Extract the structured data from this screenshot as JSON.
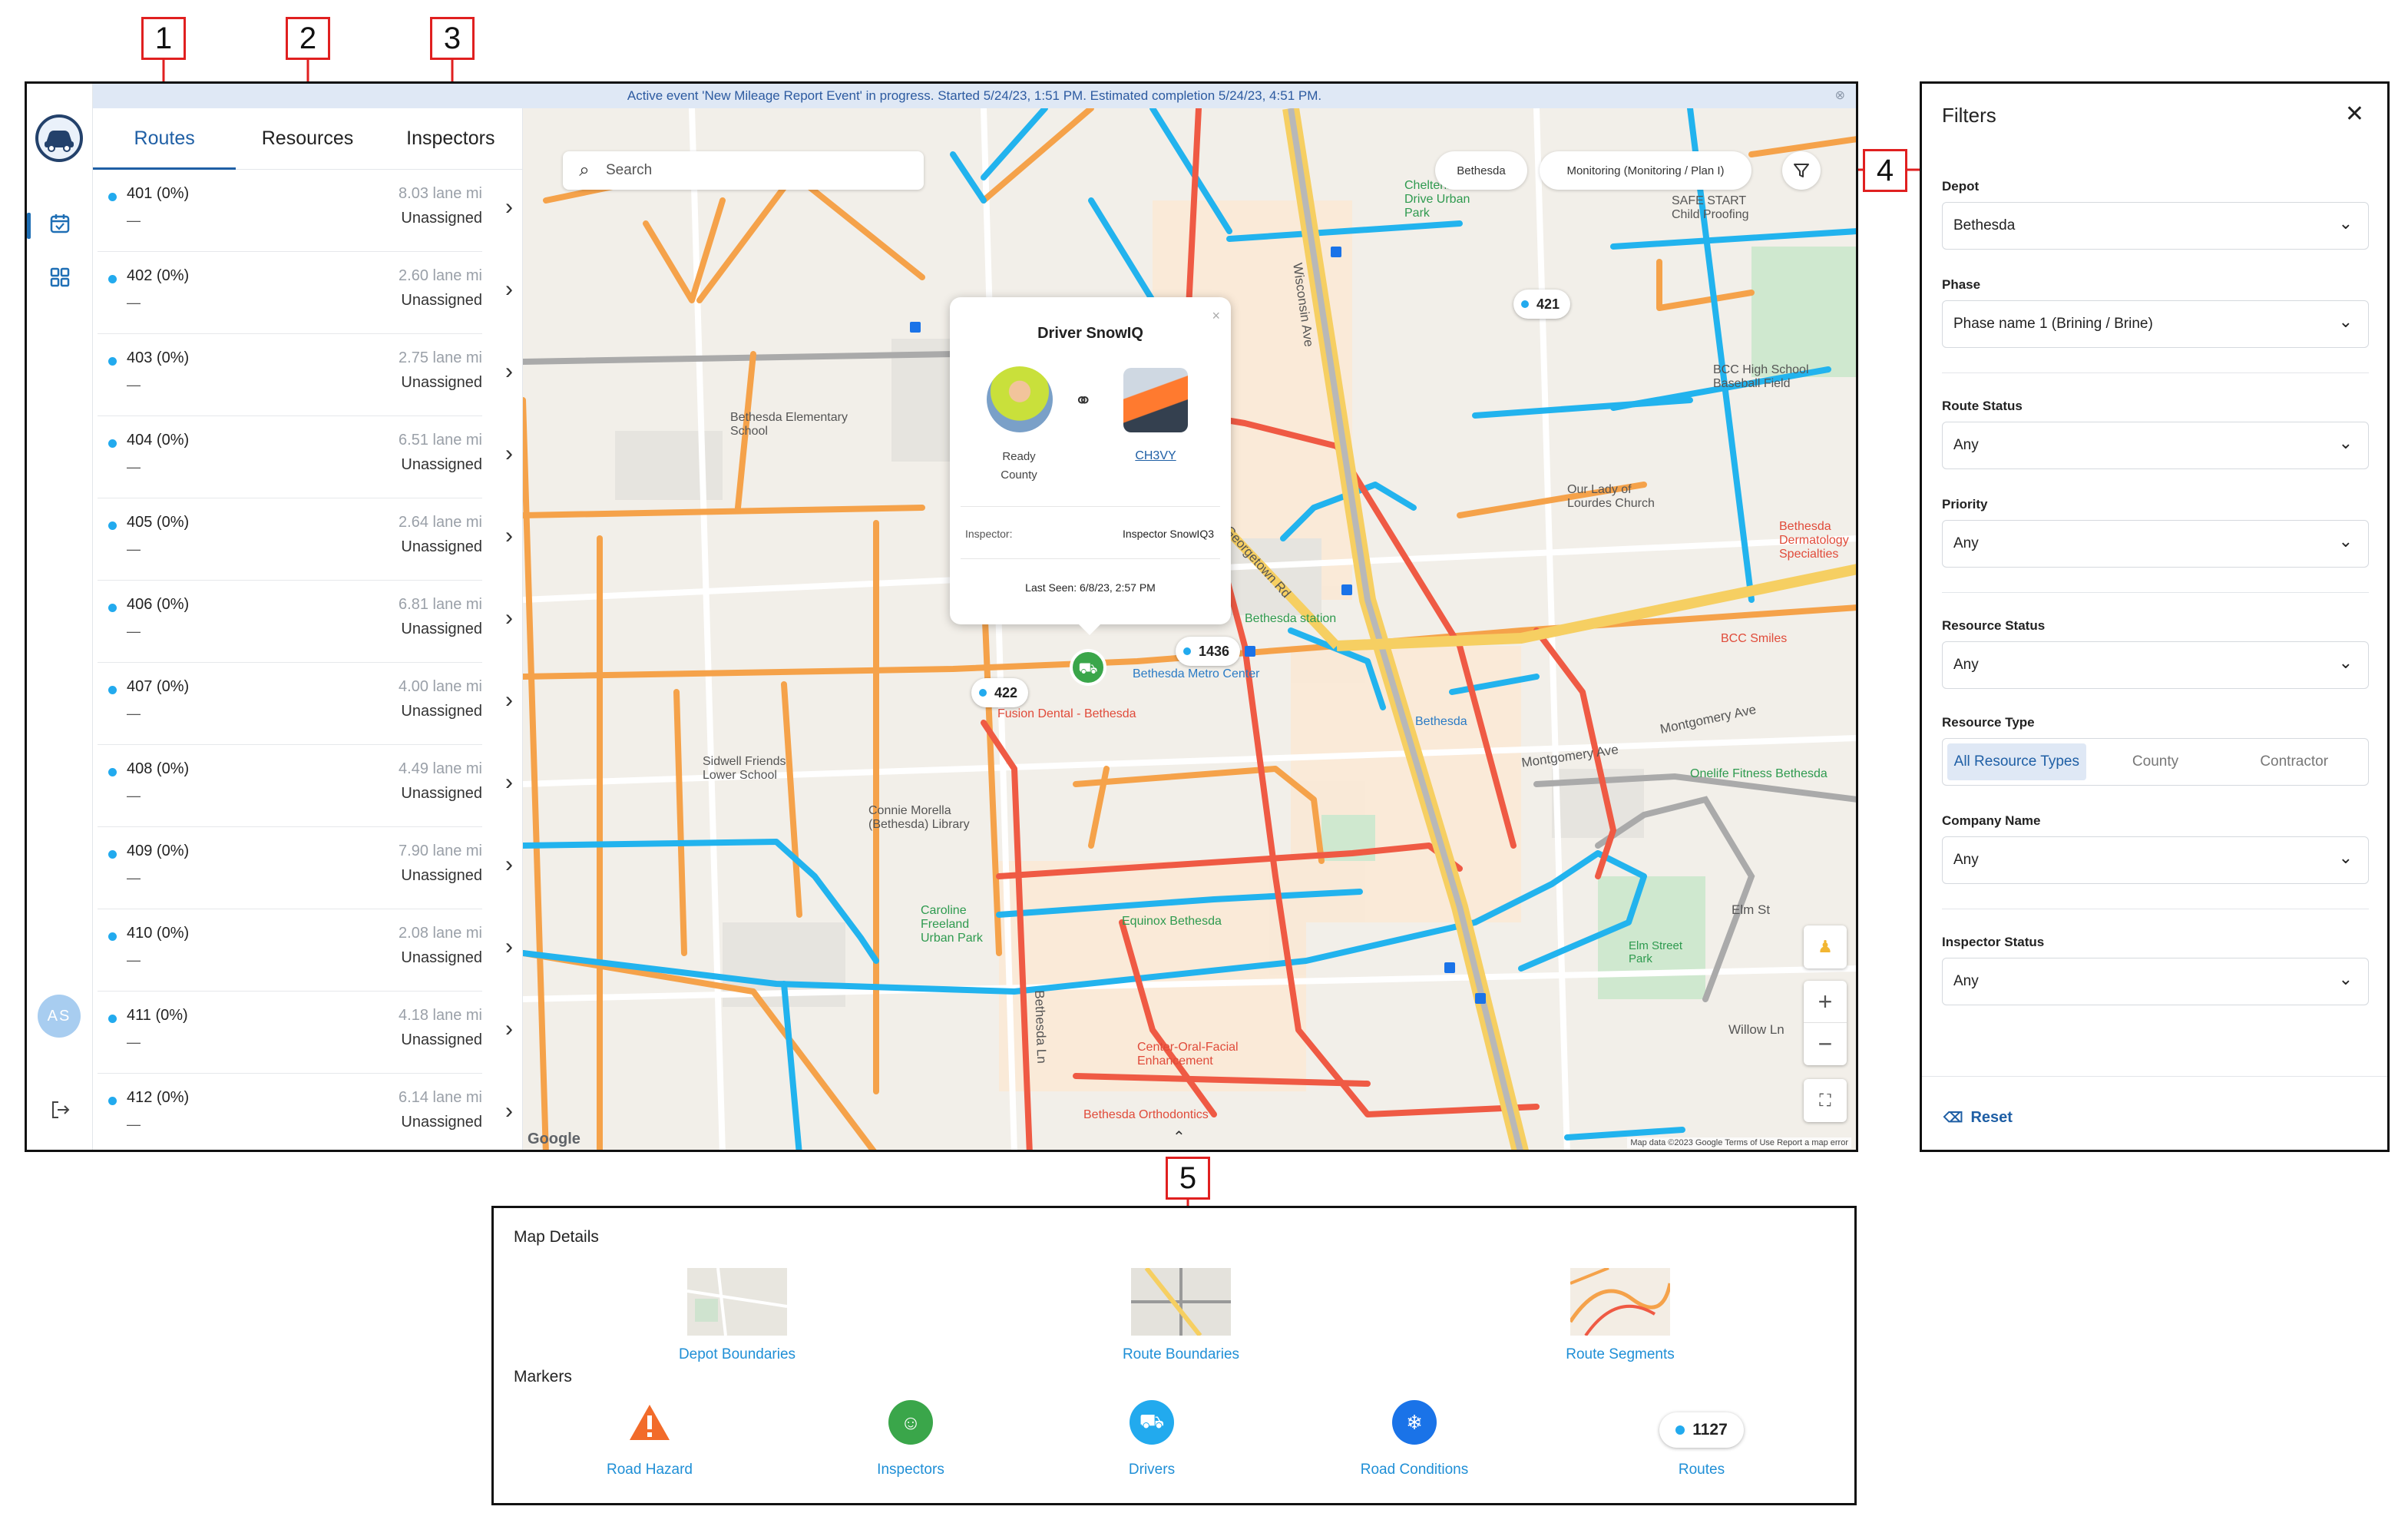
{
  "callouts": [
    "1",
    "2",
    "3",
    "4",
    "5"
  ],
  "banner": {
    "text": "Active event 'New Mileage Report Event' in progress. Started 5/24/23, 1:51 PM. Estimated completion 5/24/23, 4:51 PM.",
    "close": "⊗"
  },
  "rail": {
    "avatar_initials": "AS"
  },
  "tabs": [
    {
      "label": "Routes",
      "active": true
    },
    {
      "label": "Resources",
      "active": false
    },
    {
      "label": "Inspectors",
      "active": false
    }
  ],
  "routes": [
    {
      "name": "401 (0%)",
      "miles": "8.03 lane mi",
      "status": "Unassigned",
      "sub": "—"
    },
    {
      "name": "402 (0%)",
      "miles": "2.60 lane mi",
      "status": "Unassigned",
      "sub": "—"
    },
    {
      "name": "403 (0%)",
      "miles": "2.75 lane mi",
      "status": "Unassigned",
      "sub": "—"
    },
    {
      "name": "404 (0%)",
      "miles": "6.51 lane mi",
      "status": "Unassigned",
      "sub": "—"
    },
    {
      "name": "405 (0%)",
      "miles": "2.64 lane mi",
      "status": "Unassigned",
      "sub": "—"
    },
    {
      "name": "406 (0%)",
      "miles": "6.81 lane mi",
      "status": "Unassigned",
      "sub": "—"
    },
    {
      "name": "407 (0%)",
      "miles": "4.00 lane mi",
      "status": "Unassigned",
      "sub": "—"
    },
    {
      "name": "408 (0%)",
      "miles": "4.49 lane mi",
      "status": "Unassigned",
      "sub": "—"
    },
    {
      "name": "409 (0%)",
      "miles": "7.90 lane mi",
      "status": "Unassigned",
      "sub": "—"
    },
    {
      "name": "410 (0%)",
      "miles": "2.08 lane mi",
      "status": "Unassigned",
      "sub": "—"
    },
    {
      "name": "411 (0%)",
      "miles": "4.18 lane mi",
      "status": "Unassigned",
      "sub": "—"
    },
    {
      "name": "412 (0%)",
      "miles": "6.14 lane mi",
      "status": "Unassigned",
      "sub": "—"
    }
  ],
  "map": {
    "search_placeholder": "Search",
    "chip_depot": "Bethesda",
    "chip_phase": "Monitoring (Monitoring / Plan I)",
    "pills": [
      "421",
      "1436",
      "422"
    ],
    "labels": {
      "wisconsin_ave": "Wisconsin Ave",
      "georgetown_rd": "Georgetown Rd",
      "montgomery_ave": "Montgomery Ave",
      "montgomery_ave2": "Montgomery Ave",
      "elm_st": "Elm St",
      "willow_ln": "Willow Ln",
      "bethesda_ln": "Bethesda Ln",
      "cheltenham": "Cheltenham Drive Urban Park",
      "safe_start": "SAFE START Child Proofing",
      "bcc_high": "BCC High School Baseball Field",
      "bethesda_elem": "Bethesda Elementary School",
      "our_lady": "Our Lady of Lourdes Church",
      "bethesda_spec": "Bethesda Dermatology Specialties",
      "bcc_smiles": "BCC Smiles",
      "bethesda_station": "Bethesda station",
      "metro_center": "Bethesda Metro Center",
      "fusion": "Fusion Dental - Bethesda",
      "sidwell": "Sidwell Friends Lower School",
      "library": "Connie Morella (Bethesda) Library",
      "bethesda_n": "Bethesda",
      "onelife": "Onelife Fitness Bethesda",
      "caroline": "Caroline Freeland Urban Park",
      "equinox": "Equinox Bethesda",
      "elm_street_park": "Elm Street Park",
      "center_oral": "Center-Oral-Facial Enhancement",
      "orthodontics": "Bethesda Orthodontics"
    },
    "attribution": "Map data ©2023 Google   Terms of Use   Report a map error",
    "google": "Google"
  },
  "popup": {
    "title": "Driver SnowIQ",
    "close": "×",
    "driver_status": "Ready",
    "driver_org": "County",
    "vehicle_id": "CH3VY",
    "inspector_label": "Inspector:",
    "inspector_value": "Inspector SnowIQ3",
    "last_seen": "Last Seen: 6/8/23, 2:57 PM"
  },
  "filters": {
    "title": "Filters",
    "close": "✕",
    "depot_label": "Depot",
    "depot_value": "Bethesda",
    "phase_label": "Phase",
    "phase_value": "Phase name 1 (Brining / Brine)",
    "route_status_label": "Route Status",
    "route_status_value": "Any",
    "priority_label": "Priority",
    "priority_value": "Any",
    "resource_status_label": "Resource Status",
    "resource_status_value": "Any",
    "resource_type_label": "Resource Type",
    "resource_types": [
      "All Resource Types",
      "County",
      "Contractor"
    ],
    "company_label": "Company Name",
    "company_value": "Any",
    "inspector_status_label": "Inspector Status",
    "inspector_status_value": "Any",
    "reset": "Reset"
  },
  "details": {
    "map_details_heading": "Map Details",
    "markers_heading": "Markers",
    "layers": [
      "Depot Boundaries",
      "Route Boundaries",
      "Route Segments"
    ],
    "markers": [
      "Road Hazard",
      "Inspectors",
      "Drivers",
      "Road Conditions",
      "Routes"
    ],
    "routes_pill": "1127"
  },
  "colors": {
    "route_blue": "#22b3ee",
    "route_orange": "#f5a24a",
    "route_red": "#ef5a44",
    "accent": "#1f5fa5"
  }
}
